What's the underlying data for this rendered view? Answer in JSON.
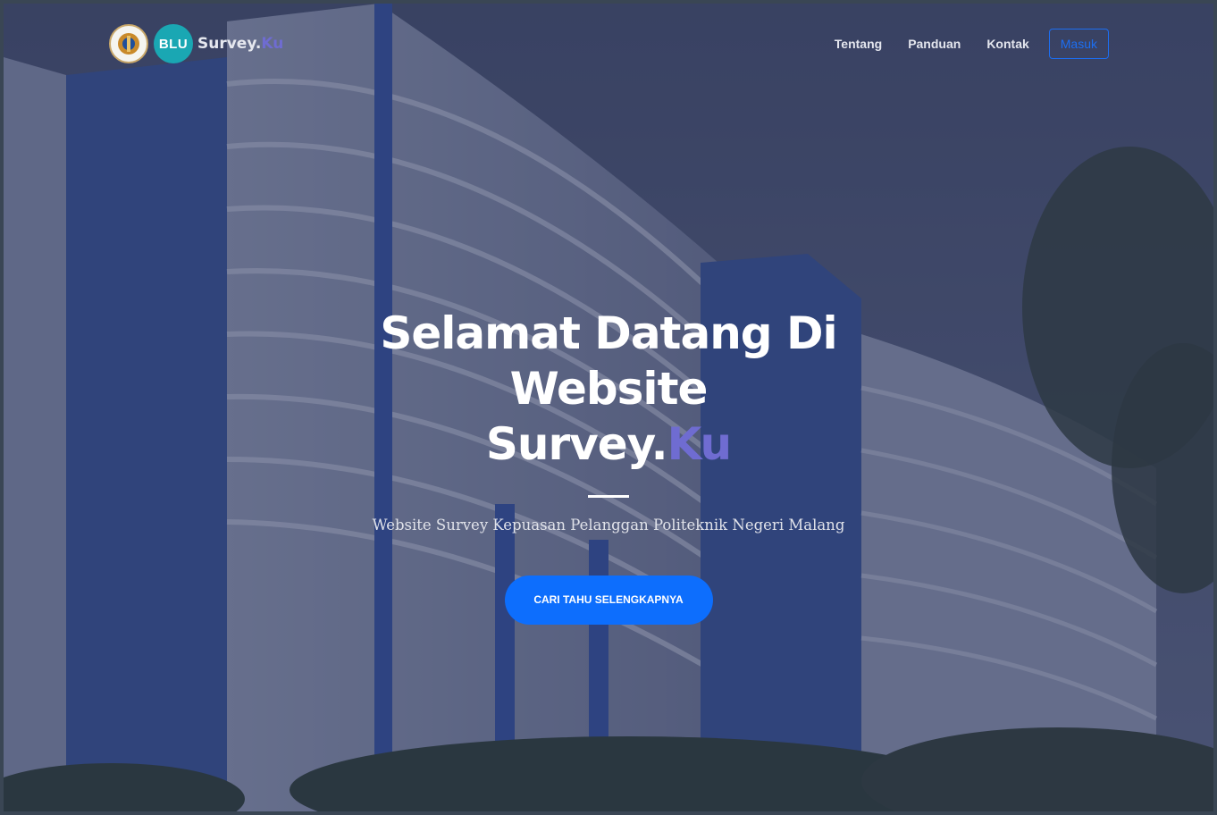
{
  "nav": {
    "brand": {
      "emblem_icon": "polinema-emblem-icon",
      "blu_logo_text": "BLU",
      "name_prefix": "Survey.",
      "name_suffix": "Ku"
    },
    "items": [
      {
        "label": "Tentang"
      },
      {
        "label": "Panduan"
      },
      {
        "label": "Kontak"
      }
    ],
    "login_label": "Masuk"
  },
  "hero": {
    "title_line1": "Selamat Datang Di Website",
    "title_line2_prefix": "Survey.",
    "title_line2_suffix": "Ku",
    "subtitle": "Website Survey Kepuasan Pelanggan Politeknik Negeri Malang",
    "cta_label": "CARI TAHU SELENGKAPNYA"
  },
  "colors": {
    "accent_ku": "#6f6cd1",
    "primary_button": "#0d6efd",
    "overlay": "#323a5c"
  }
}
